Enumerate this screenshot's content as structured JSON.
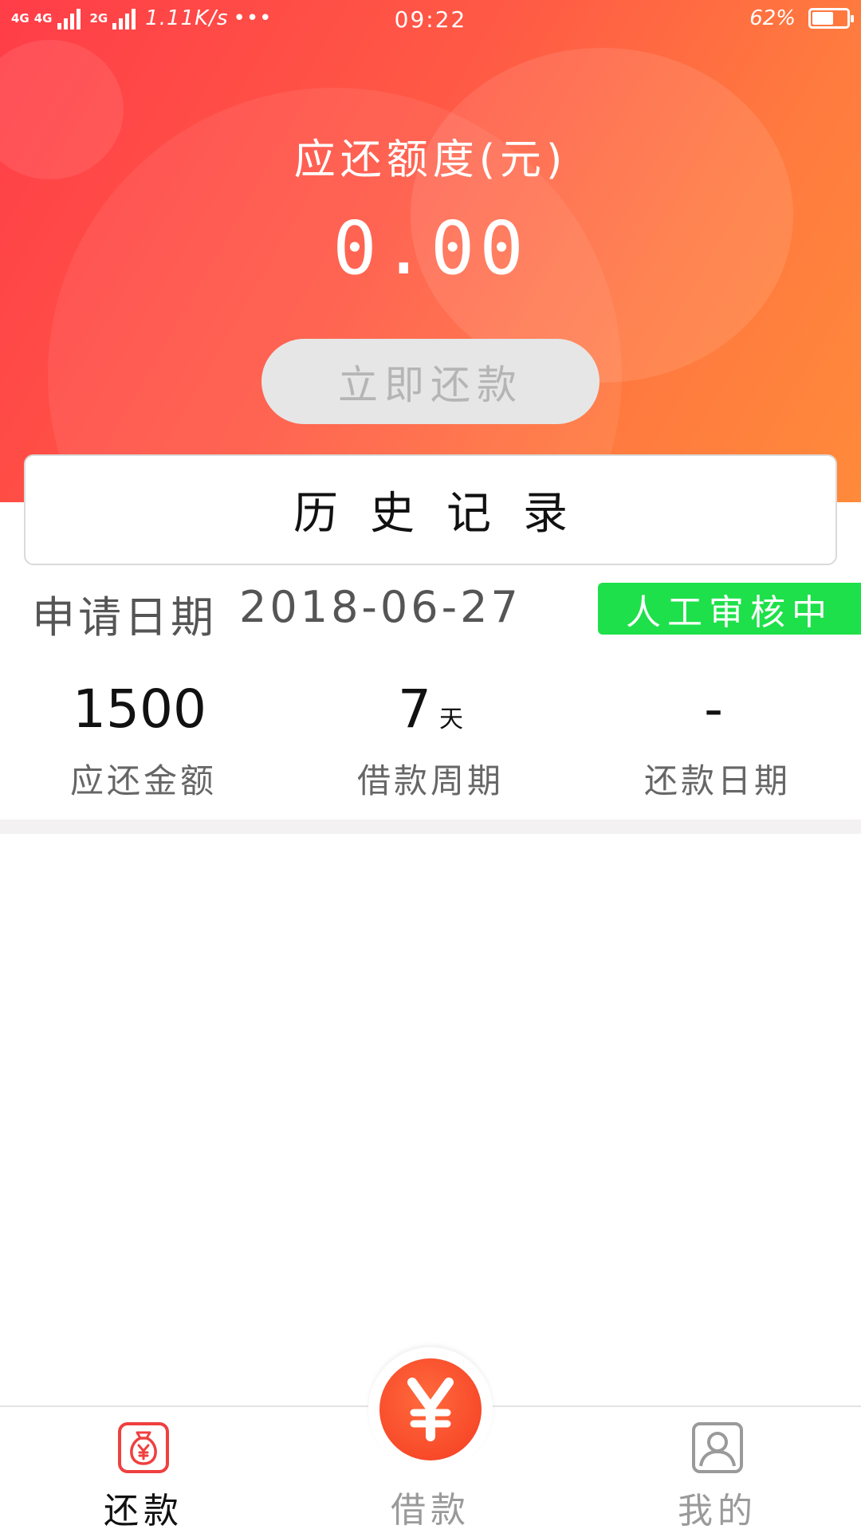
{
  "status_bar": {
    "network_1": "4G",
    "network_2": "4G",
    "network_3": "2G",
    "speed": "1.11K/s",
    "more": "•••",
    "time": "09:22",
    "battery_percent": "62%",
    "battery_level": 0.62
  },
  "header": {
    "due_label": "应还额度(元)",
    "due_amount": "0.00",
    "repay_button_label": "立即还款"
  },
  "history": {
    "title": "历史记录"
  },
  "record": {
    "apply_date_label": "申请日期",
    "apply_date": "2018-06-27",
    "status": "人工审核中",
    "stats": [
      {
        "value": "1500",
        "unit": "",
        "label": "应还金额"
      },
      {
        "value": "7",
        "unit": "天",
        "label": "借款周期"
      },
      {
        "value": "-",
        "unit": "",
        "label": "还款日期"
      }
    ]
  },
  "bottom_nav": {
    "items": [
      {
        "label": "还款",
        "icon": "money-bag-icon",
        "active": true
      },
      {
        "label": "借款",
        "icon": "yen-icon",
        "active": false
      },
      {
        "label": "我的",
        "icon": "profile-icon",
        "active": false
      }
    ]
  },
  "colors": {
    "accent_red": "#ff3d48",
    "accent_orange": "#ff8a3a",
    "status_green": "#1ee04a"
  }
}
